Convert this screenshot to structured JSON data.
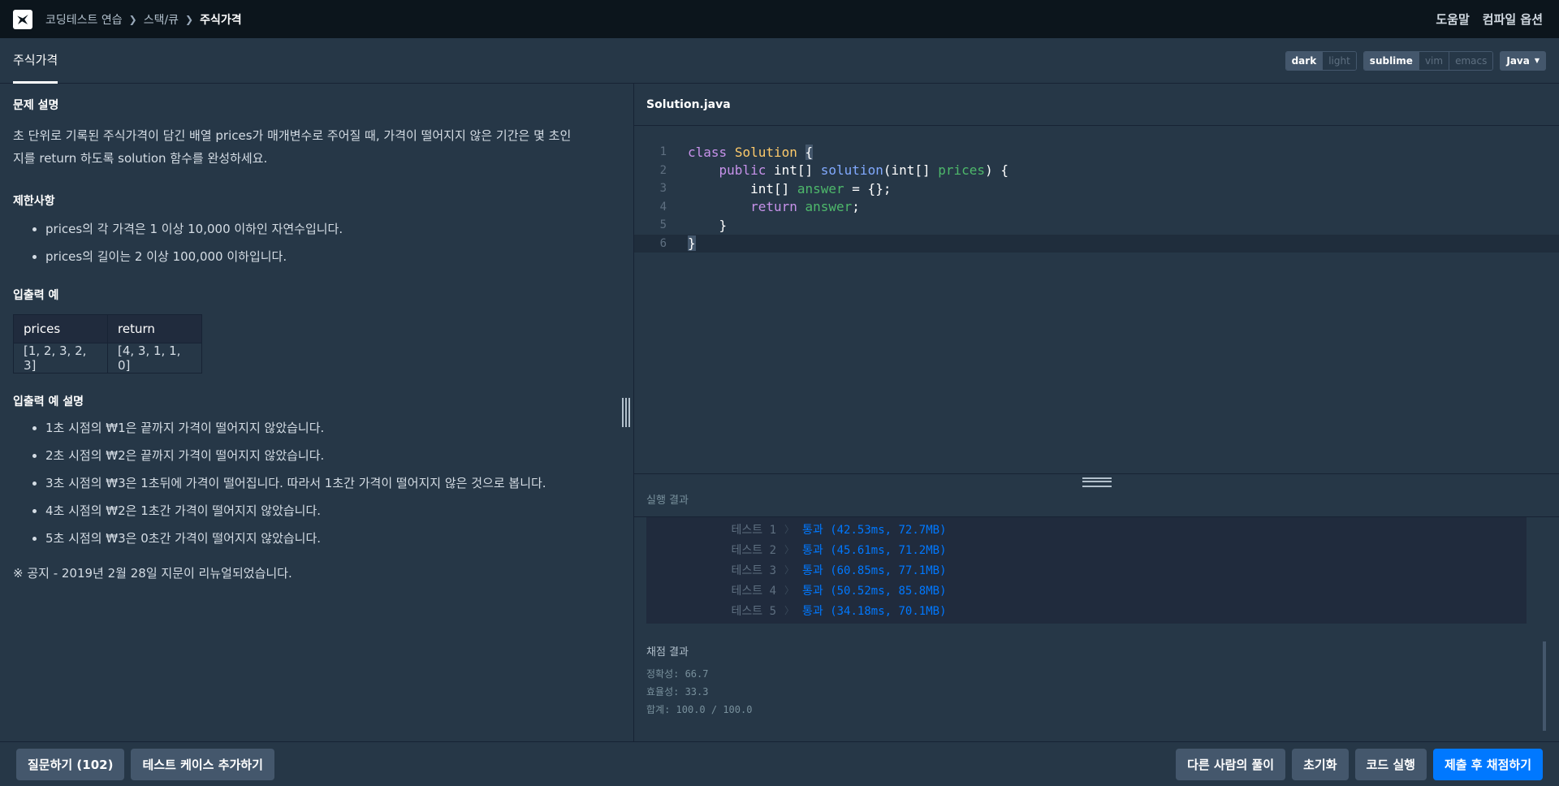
{
  "topbar": {
    "breadcrumbs": [
      "코딩테스트 연습",
      "스택/큐",
      "주식가격"
    ],
    "help": "도움말",
    "compile_options": "컴파일 옵션"
  },
  "tab": {
    "title": "주식가격"
  },
  "controls": {
    "theme": [
      "dark",
      "light"
    ],
    "theme_selected": "dark",
    "keymap": [
      "sublime",
      "vim",
      "emacs"
    ],
    "keymap_selected": "sublime",
    "language": "Java"
  },
  "problem": {
    "desc_title": "문제 설명",
    "desc_line1": "초 단위로 기록된 주식가격이 담긴 배열 prices가 매개변수로 주어질 때, 가격이 떨어지지 않은 기간은 몇 초인",
    "desc_line2": "지를 return 하도록 solution 함수를 완성하세요.",
    "constraints_title": "제한사항",
    "constraints": [
      "prices의 각 가격은 1 이상 10,000 이하인 자연수입니다.",
      "prices의 길이는 2 이상 100,000 이하입니다."
    ],
    "io_title": "입출력 예",
    "io_headers": [
      "prices",
      "return"
    ],
    "io_rows": [
      [
        "[1, 2, 3, 2, 3]",
        "[4, 3, 1, 1, 0]"
      ]
    ],
    "io_desc_title": "입출력 예 설명",
    "io_desc": [
      "1초 시점의 ₩1은 끝까지 가격이 떨어지지 않았습니다.",
      "2초 시점의 ₩2은 끝까지 가격이 떨어지지 않았습니다.",
      "3초 시점의 ₩3은 1초뒤에 가격이 떨어집니다. 따라서 1초간 가격이 떨어지지 않은 것으로 봅니다.",
      "4초 시점의 ₩2은 1초간 가격이 떨어지지 않았습니다.",
      "5초 시점의 ₩3은 0초간 가격이 떨어지지 않았습니다."
    ],
    "notice": "※ 공지 - 2019년 2월 28일 지문이 리뉴얼되었습니다."
  },
  "editor": {
    "filename": "Solution.java",
    "line_numbers": [
      "1",
      "2",
      "3",
      "4",
      "5",
      "6"
    ]
  },
  "results": {
    "title": "실행 결과",
    "tests": [
      {
        "name": "테스트 1",
        "result": "통과 (42.53ms, 72.7MB)"
      },
      {
        "name": "테스트 2",
        "result": "통과 (45.61ms, 71.2MB)"
      },
      {
        "name": "테스트 3",
        "result": "통과 (60.85ms, 77.1MB)"
      },
      {
        "name": "테스트 4",
        "result": "통과 (50.52ms, 85.8MB)"
      },
      {
        "name": "테스트 5",
        "result": "통과 (34.18ms, 70.1MB)"
      }
    ],
    "grade_title": "채점 결과",
    "accuracy": "정확성: 66.7",
    "efficiency": "효율성: 33.3",
    "total": "합계: 100.0 / 100.0"
  },
  "bottom": {
    "ask": "질문하기 (102)",
    "add_testcase": "테스트 케이스 추가하기",
    "others_solution": "다른 사람의 풀이",
    "reset": "초기화",
    "run": "코드 실행",
    "submit": "제출 후 채점하기"
  },
  "colors": {
    "primary": "#0078ff",
    "background": "#263747",
    "topbar": "#0c151c"
  }
}
